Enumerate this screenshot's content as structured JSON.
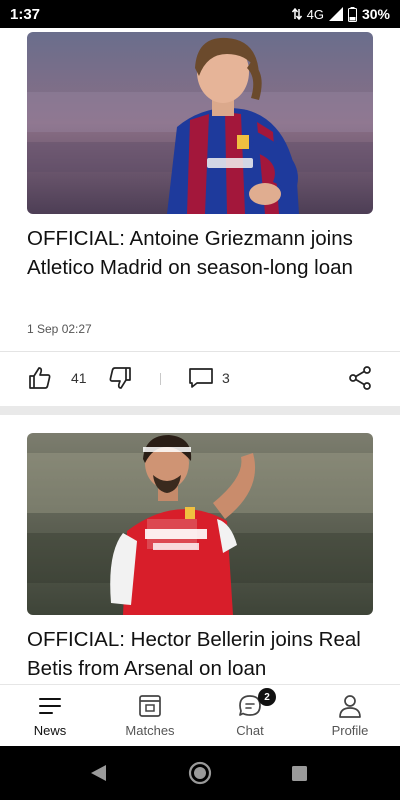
{
  "status_bar": {
    "time": "1:37",
    "network": "4G",
    "battery": "30%"
  },
  "articles": [
    {
      "headline": "OFFICIAL: Antoine Griezmann joins Atletico Madrid on season-long loan",
      "date": "1 Sep 02:27",
      "likes": "41",
      "comments": "3",
      "image_icon": "player-photo-barcelona-kit"
    },
    {
      "headline": "OFFICIAL: Hector Bellerin joins Real Betis from Arsenal on loan",
      "image_icon": "player-photo-arsenal-kit"
    }
  ],
  "bottom_nav": {
    "items": [
      {
        "label": "News",
        "icon": "news-icon"
      },
      {
        "label": "Matches",
        "icon": "matches-icon"
      },
      {
        "label": "Chat",
        "icon": "chat-icon",
        "badge": "2"
      },
      {
        "label": "Profile",
        "icon": "profile-icon"
      }
    ]
  },
  "colors": {
    "background": "#ffffff",
    "text": "#111111",
    "divider": "#e9e9e9",
    "status_bar": "#000000"
  }
}
